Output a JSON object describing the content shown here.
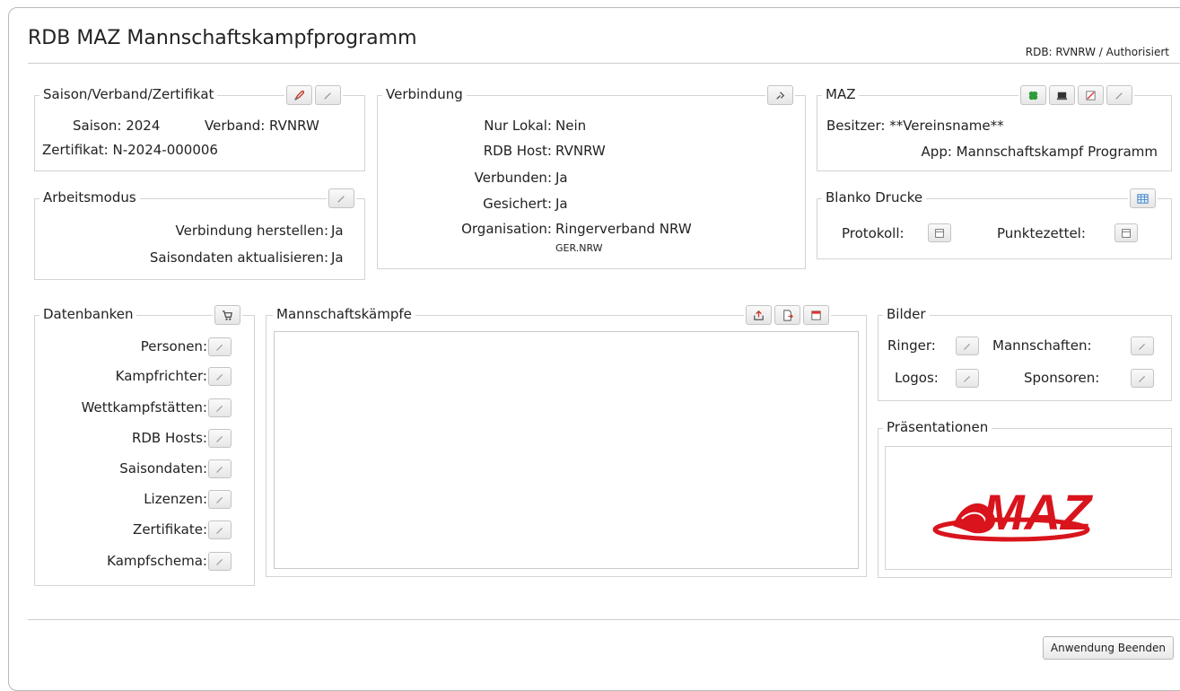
{
  "app": {
    "title": "RDB MAZ Mannschaftskampfprogramm",
    "auth_status": "RDB: RVNRW / Authorisiert"
  },
  "saison": {
    "legend": "Saison/Verband/Zertifikat",
    "saison_line": "Saison: 2024",
    "verband_line": "Verband: RVNRW",
    "zertifikat_line": "Zertifikat: N-2024-000006",
    "icons": [
      "rocket-icon",
      "pencil-icon"
    ]
  },
  "arbeitsmodus": {
    "legend": "Arbeitsmodus",
    "rows": [
      {
        "label": "Verbindung herstellen:",
        "value": "Ja"
      },
      {
        "label": "Saisondaten aktualisieren:",
        "value": "Ja"
      }
    ]
  },
  "verbindung": {
    "legend": "Verbindung",
    "rows": [
      {
        "label": "Nur Lokal:",
        "value": "Nein"
      },
      {
        "label": "RDB Host:",
        "value": "RVNRW"
      },
      {
        "label": "Verbunden:",
        "value": "Ja"
      },
      {
        "label": "Gesichert:",
        "value": "Ja"
      },
      {
        "label": "Organisation:",
        "value": "Ringerverband NRW"
      }
    ],
    "organisation_code": "GER.NRW",
    "icons": [
      "connect-icon"
    ]
  },
  "maz": {
    "legend": "MAZ",
    "besitzer": "Besitzer: **Vereinsname**",
    "app": "App: Mannschaftskampf Programm",
    "icons": [
      "clover-icon",
      "monitor-icon",
      "chart-icon",
      "pencil-icon"
    ]
  },
  "blanko": {
    "legend": "Blanko Drucke",
    "protokoll": "Protokoll:",
    "punktezettel": "Punktezettel:",
    "icons": [
      "table-icon"
    ]
  },
  "datenbanken": {
    "legend": "Datenbanken",
    "items": [
      "Personen:",
      "Kampfrichter:",
      "Wettkampfstätten:",
      "RDB Hosts:",
      "Saisondaten:",
      "Lizenzen:",
      "Zertifikate:",
      "Kampfschema:"
    ],
    "icons": [
      "cart-icon"
    ]
  },
  "mannschaftskaempfe": {
    "legend": "Mannschaftskämpfe",
    "icons": [
      "export-icon",
      "new-document-icon",
      "calendar-icon"
    ]
  },
  "bilder": {
    "legend": "Bilder",
    "ringer": "Ringer:",
    "mannschaften": "Mannschaften:",
    "logos": "Logos:",
    "sponsoren": "Sponsoren:"
  },
  "praesentationen": {
    "legend": "Präsentationen",
    "logo_text": "MAZ",
    "accent": "#d9141c"
  },
  "footer": {
    "quit_label": "Anwendung Beenden"
  }
}
